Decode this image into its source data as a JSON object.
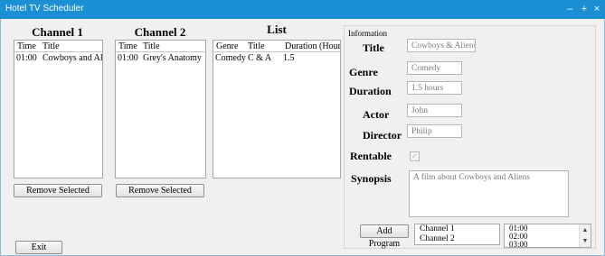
{
  "window": {
    "title": "Hotel TV Scheduler",
    "controls": {
      "minimize": "–",
      "maximize": "+",
      "close": "×"
    }
  },
  "channel1": {
    "heading": "Channel 1",
    "columns": [
      "Time",
      "Title"
    ],
    "rows": [
      {
        "time": "01:00",
        "title": "Cowboys and Al..."
      }
    ],
    "remove_label": "Remove Selected"
  },
  "channel2": {
    "heading": "Channel 2",
    "columns": [
      "Time",
      "Title"
    ],
    "rows": [
      {
        "time": "01:00",
        "title": "Grey's Anatomy"
      }
    ],
    "remove_label": "Remove Selected"
  },
  "list": {
    "heading": "List",
    "columns": [
      "Genre",
      "Title",
      "Duration (Hours)"
    ],
    "rows": [
      {
        "genre": "Comedy",
        "title": "C & A",
        "duration": "1.5"
      }
    ]
  },
  "exit_label": "Exit",
  "info": {
    "group_title": "Information",
    "title_label": "Title",
    "title_value": "Cowboys & Aliens",
    "genre_label": "Genre",
    "genre_value": "Comedy",
    "duration_label": "Duration",
    "duration_value": "1.5 hours",
    "actor_label": "Actor",
    "actor_value": "John",
    "director_label": "Director",
    "director_value": "Philip",
    "rentable_label": "Rentable",
    "rentable_checked": true,
    "rentable_mark": "✓",
    "synopsis_label": "Synopsis",
    "synopsis_value": "A film about Cowboys and Aliens",
    "add_program_label": "Add Program",
    "channel_options": [
      "Channel 1",
      "Channel 2"
    ],
    "time_options": [
      "01:00",
      "02:00",
      "03:00"
    ],
    "scroll_up": "▲",
    "scroll_down": "▼"
  },
  "colors": {
    "titlebar": "#1b8fd3",
    "window_border": "#8fb8d8"
  }
}
